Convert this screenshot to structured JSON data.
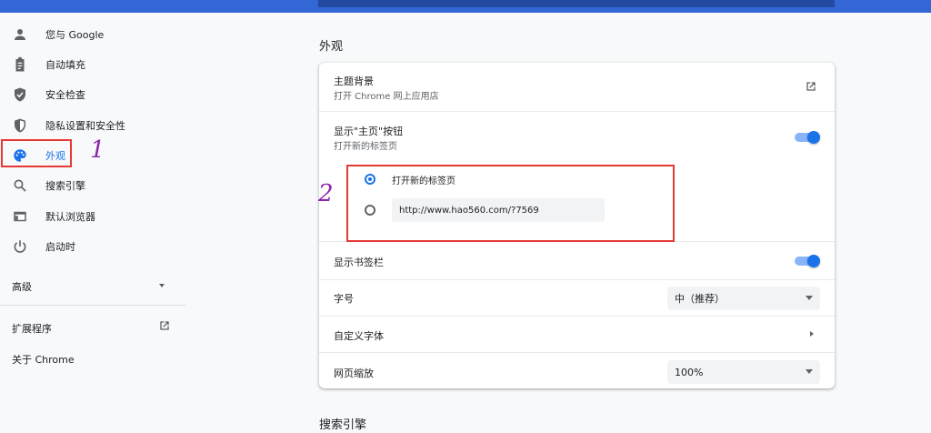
{
  "sidebar": {
    "items": [
      {
        "label": "您与 Google",
        "icon": "person-icon"
      },
      {
        "label": "自动填充",
        "icon": "clipboard-icon"
      },
      {
        "label": "安全检查",
        "icon": "shield-check-icon"
      },
      {
        "label": "隐私设置和安全性",
        "icon": "shield-icon"
      },
      {
        "label": "外观",
        "icon": "palette-icon"
      },
      {
        "label": "搜索引擎",
        "icon": "search-icon"
      },
      {
        "label": "默认浏览器",
        "icon": "browser-icon"
      },
      {
        "label": "启动时",
        "icon": "power-icon"
      }
    ],
    "advanced_label": "高级",
    "extensions_label": "扩展程序",
    "about_label": "关于 Chrome"
  },
  "annotations": {
    "one": "1",
    "two": "2"
  },
  "appearance": {
    "section_title": "外观",
    "theme": {
      "title": "主题背景",
      "subtitle": "打开 Chrome 网上应用店"
    },
    "home_button": {
      "title": "显示\"主页\"按钮",
      "subtitle": "打开新的标签页",
      "enabled": true,
      "options": [
        {
          "label": "打开新的标签页",
          "selected": true
        },
        {
          "value": "http://www.hao560.com/?7569",
          "selected": false
        }
      ]
    },
    "bookmarks_bar": {
      "title": "显示书签栏",
      "enabled": true
    },
    "font_size": {
      "title": "字号",
      "value": "中（推荐）"
    },
    "custom_fonts": {
      "title": "自定义字体"
    },
    "page_zoom": {
      "title": "网页缩放",
      "value": "100%"
    }
  },
  "search_engine": {
    "section_title": "搜索引擎"
  },
  "colors": {
    "accent": "#1a73e8",
    "annotation_red": "#e53935",
    "annotation_purple": "#8e24aa",
    "header_blue": "#3367d6"
  }
}
